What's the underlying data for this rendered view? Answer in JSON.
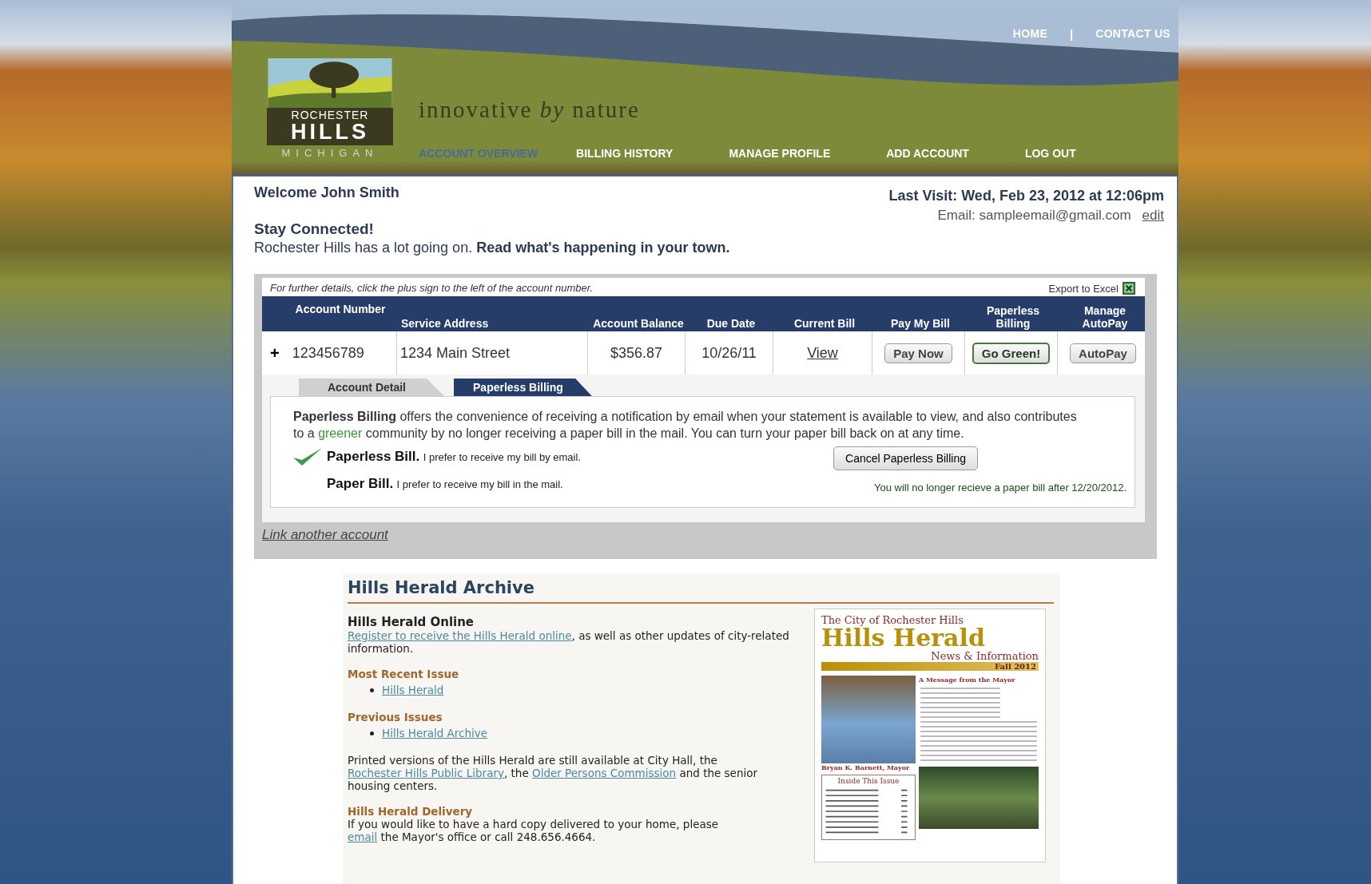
{
  "top_links": [
    {
      "kind": "link",
      "text": "HOME"
    },
    {
      "kind": "separator",
      "text": "|"
    },
    {
      "kind": "link",
      "text": "CONTACT US"
    }
  ],
  "logo": {
    "line1": "ROCHESTER",
    "line2": "HILLS",
    "line3": "MICHIGAN"
  },
  "tagline": "innovative *by* nature",
  "nav": [
    {
      "label": "ACCOUNT OVERVIEW",
      "selected": true
    },
    {
      "label": "BILLING HISTORY",
      "selected": false
    },
    {
      "label": "MANAGE PROFILE",
      "selected": false
    },
    {
      "label": "ADD ACCOUNT",
      "selected": false
    },
    {
      "label": "LOG OUT",
      "selected": false
    }
  ],
  "welcome": "Welcome John Smith",
  "last_visit": "Last Visit: Wed, Feb 23, 2012 at 12:06pm",
  "email": "Email: sampleemail@gmail.com",
  "email_edit": "edit",
  "stay_title": "Stay Connected!",
  "stay_text": "Rochester Hills has a lot going on. **Read what's happening in your town.**",
  "accounts": {
    "hint": "For further details, click the plus sign to the left of the account number.",
    "export": "Export to Excel",
    "columns": [
      "Account Number",
      "Service Address",
      "Account Balance",
      "Due Date",
      "Current Bill",
      "Pay My Bill",
      "Paperless Billing",
      "Manage AutoPay"
    ],
    "rows": [
      {
        "cells": [
          {
            "kind": "account",
            "expand": "+",
            "text": "123456789"
          },
          {
            "kind": "text",
            "text": "1234 Main Street"
          },
          {
            "kind": "number",
            "text": "$356.87"
          },
          {
            "kind": "number",
            "text": "10/26/11"
          },
          {
            "kind": "link",
            "text": "View"
          },
          {
            "kind": "button",
            "text": "Pay Now"
          },
          {
            "kind": "primary-button",
            "text": "Go Green!"
          },
          {
            "kind": "button",
            "text": "AutoPay"
          }
        ]
      }
    ]
  },
  "detail_tabs": [
    {
      "label": "Account Detail",
      "selected": false
    },
    {
      "label": "Paperless Billing",
      "selected": true
    }
  ],
  "paperless": {
    "intro": [
      {
        "kind": "bold",
        "text": "Paperless Billing"
      },
      {
        "kind": "plain",
        "text": " offers the convenience of receiving a notification by email when your statement is available to view, and also contributes to a "
      },
      {
        "kind": "green",
        "text": "greener"
      },
      {
        "kind": "plain",
        "text": " community by no longer receiving a paper bill in the mail. You can turn your paper bill back on at any time."
      }
    ],
    "options": [
      {
        "title": "Paperless Bill.",
        "text": "I prefer to receive my bill by email.",
        "checked": true
      },
      {
        "title": "Paper Bill.",
        "text": "I prefer to receive my bill in the mail.",
        "checked": false
      }
    ],
    "cancel_button": "Cancel Paperless Billing",
    "notice": "You will no longer recieve a paper bill after 12/20/2012."
  },
  "link_account": "Link another account",
  "herald": {
    "title": "Hills Herald Archive",
    "online_title": "Hills Herald Online",
    "online_link": "Register to receive the Hills Herald online",
    "online_text": ", as well as other updates of city-related information.",
    "recent_title": "Most Recent Issue",
    "recent_links": [
      "Hills Herald"
    ],
    "previous_title": "Previous Issues",
    "previous_links": [
      "Hills Herald Archive"
    ],
    "printed": [
      {
        "kind": "plain",
        "text": "Printed versions of the Hills Herald are still available at City Hall, the "
      },
      {
        "kind": "link",
        "text": "Rochester Hills Public Library"
      },
      {
        "kind": "plain",
        "text": ", the "
      },
      {
        "kind": "link",
        "text": "Older Persons Commission"
      },
      {
        "kind": "plain",
        "text": " and the senior housing centers."
      }
    ],
    "delivery_title": "Hills Herald Delivery",
    "delivery": [
      {
        "kind": "plain",
        "text": "If you would like to have a hard copy delivered to your home, please "
      },
      {
        "kind": "link",
        "text": "email"
      },
      {
        "kind": "plain",
        "text": " the Mayor's office or call 248.656.4664."
      }
    ],
    "cover": {
      "kicker": "The City of Rochester Hills",
      "name": "Hills Herald",
      "sub": "News & Information",
      "season": "Fall 2012",
      "headline": "A Message from the Mayor",
      "caption": "Bryan K. Barnett, Mayor",
      "inside": "Inside This Issue"
    }
  }
}
